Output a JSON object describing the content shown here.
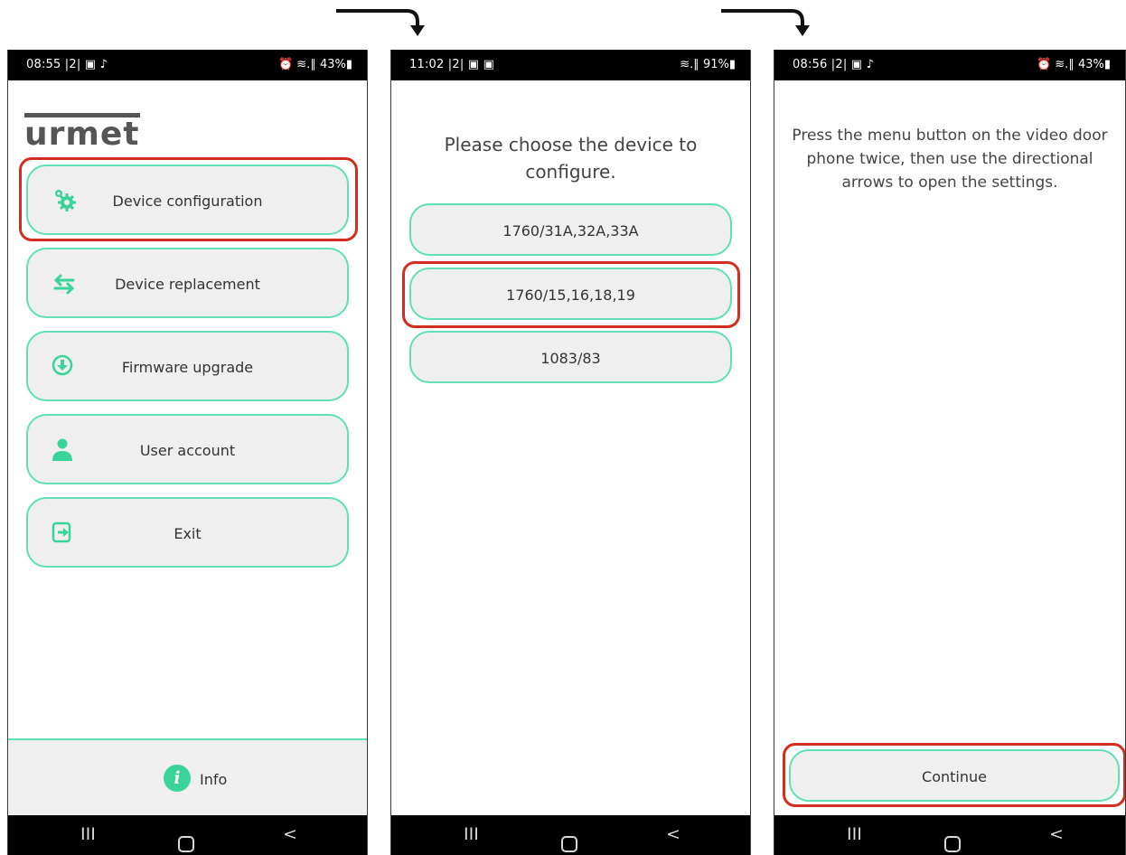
{
  "screen1": {
    "status": {
      "time": "08:55 |2| ▣ ♪",
      "right": "⏰ ≋.∥ 43%▮"
    },
    "logo": "urmet",
    "menu": [
      {
        "label": "Device configuration",
        "icon": "gear-icon"
      },
      {
        "label": "Device replacement",
        "icon": "swap-arrows-icon"
      },
      {
        "label": "Firmware upgrade",
        "icon": "download-circle-icon"
      },
      {
        "label": "User account",
        "icon": "user-icon"
      },
      {
        "label": "Exit",
        "icon": "exit-icon"
      }
    ],
    "info": {
      "icon_glyph": "i",
      "label": "Info"
    },
    "nav": {
      "recent": "III",
      "back": "<"
    }
  },
  "screen2": {
    "status": {
      "time": "11:02 |2| ▣ ▣",
      "right": "≋.∥ 91%▮"
    },
    "heading_line1": "Please choose the device to",
    "heading_line2": "configure.",
    "devices": [
      "1760/31A,32A,33A",
      "1760/15,16,18,19",
      "1083/83"
    ],
    "nav": {
      "recent": "III",
      "back": "<"
    }
  },
  "screen3": {
    "status": {
      "time": "08:56 |2| ▣ ♪",
      "right": "⏰ ≋.∥ 43%▮"
    },
    "instruction_line1": "Press the menu button on the video door",
    "instruction_line2": "phone twice, then use the directional",
    "instruction_line3": "arrows to open the settings.",
    "continue_label": "Continue",
    "nav": {
      "recent": "III",
      "back": "<"
    }
  },
  "colors": {
    "accent": "#5fe0b5",
    "icon": "#3ad39a",
    "highlight": "#d22d20",
    "button_bg": "#efefef"
  }
}
